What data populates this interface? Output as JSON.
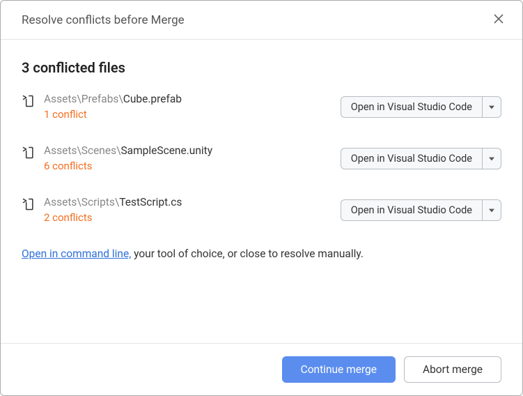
{
  "header": {
    "title": "Resolve conflicts before Merge"
  },
  "section_title": "3 conflicted files",
  "open_button_label": "Open in Visual Studio Code",
  "files": [
    {
      "dir": "Assets\\Prefabs\\",
      "name": "Cube.prefab",
      "conflicts": "1 conflict"
    },
    {
      "dir": "Assets\\Scenes\\",
      "name": "SampleScene.unity",
      "conflicts": "6 conflicts"
    },
    {
      "dir": "Assets\\Scripts\\",
      "name": "TestScript.cs",
      "conflicts": "2 conflicts"
    }
  ],
  "bottom": {
    "link": "Open in command line,",
    "rest": " your tool of choice, or close to resolve manually."
  },
  "footer": {
    "continue": "Continue merge",
    "abort": "Abort merge"
  }
}
